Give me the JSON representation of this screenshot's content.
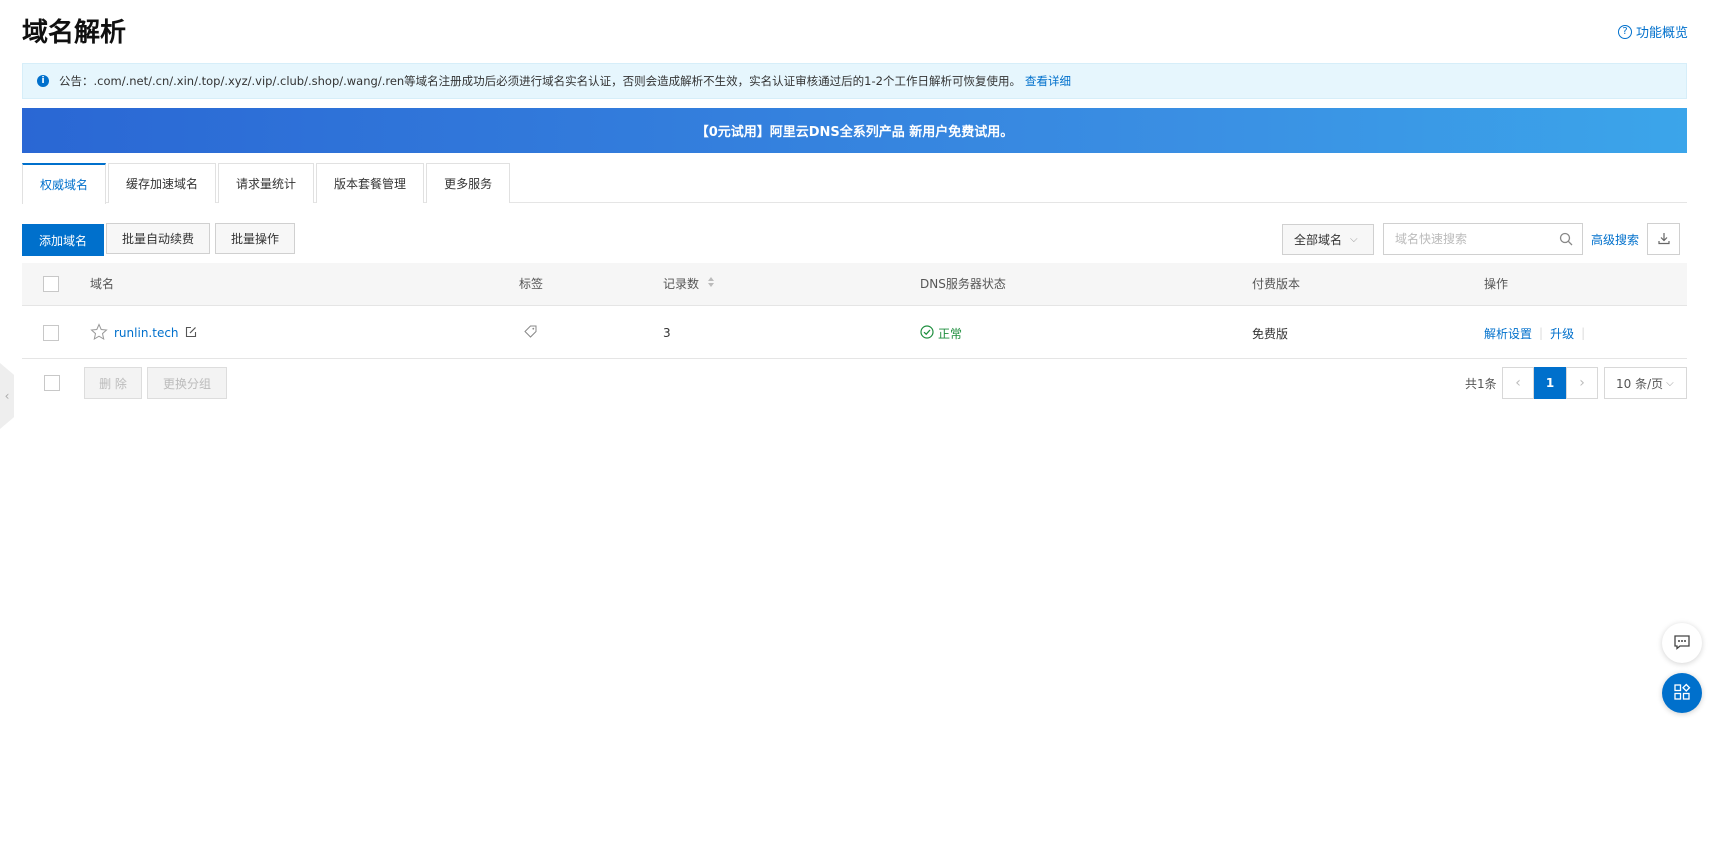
{
  "header": {
    "title": "域名解析",
    "overview_link": "功能概览"
  },
  "notice": {
    "text": "公告：.com/.net/.cn/.xin/.top/.xyz/.vip/.club/.shop/.wang/.ren等域名注册成功后必须进行域名实名认证，否则会造成解析不生效，实名认证审核通过后的1-2个工作日解析可恢复使用。",
    "link": "查看详细"
  },
  "banner": {
    "text": "【0元试用】阿里云DNS全系列产品 新用户免费试用。"
  },
  "tabs": [
    {
      "label": "权威域名",
      "active": true
    },
    {
      "label": "缓存加速域名",
      "active": false
    },
    {
      "label": "请求量统计",
      "active": false
    },
    {
      "label": "版本套餐管理",
      "active": false
    },
    {
      "label": "更多服务",
      "active": false
    }
  ],
  "toolbar": {
    "add_label": "添加域名",
    "batch_renew_label": "批量自动续费",
    "batch_ops_label": "批量操作",
    "filter_value": "全部域名",
    "search_placeholder": "域名快速搜索",
    "advanced_search_label": "高级搜索"
  },
  "table": {
    "columns": [
      "域名",
      "标签",
      "记录数",
      "DNS服务器状态",
      "付费版本",
      "操作"
    ],
    "rows": [
      {
        "domain": "runlin.tech",
        "tag": "",
        "records": "3",
        "dns_status": "正常",
        "edition": "免费版",
        "actions": [
          "解析设置",
          "升级"
        ]
      }
    ]
  },
  "footer": {
    "delete_label": "删 除",
    "change_group_label": "更换分组"
  },
  "pagination": {
    "total": "共1条",
    "current_page": "1",
    "page_size": "10 条/页"
  },
  "colors": {
    "primary": "#0070cc",
    "success": "#1e8e3e",
    "notice_bg": "#e6f6fd"
  },
  "icons": [
    "question-circle-icon",
    "info-icon",
    "search-icon",
    "download-icon",
    "star-icon",
    "edit-icon",
    "tag-icon",
    "check-circle-icon",
    "chevron-left-icon",
    "chevron-right-icon",
    "chat-icon",
    "apps-icon"
  ]
}
